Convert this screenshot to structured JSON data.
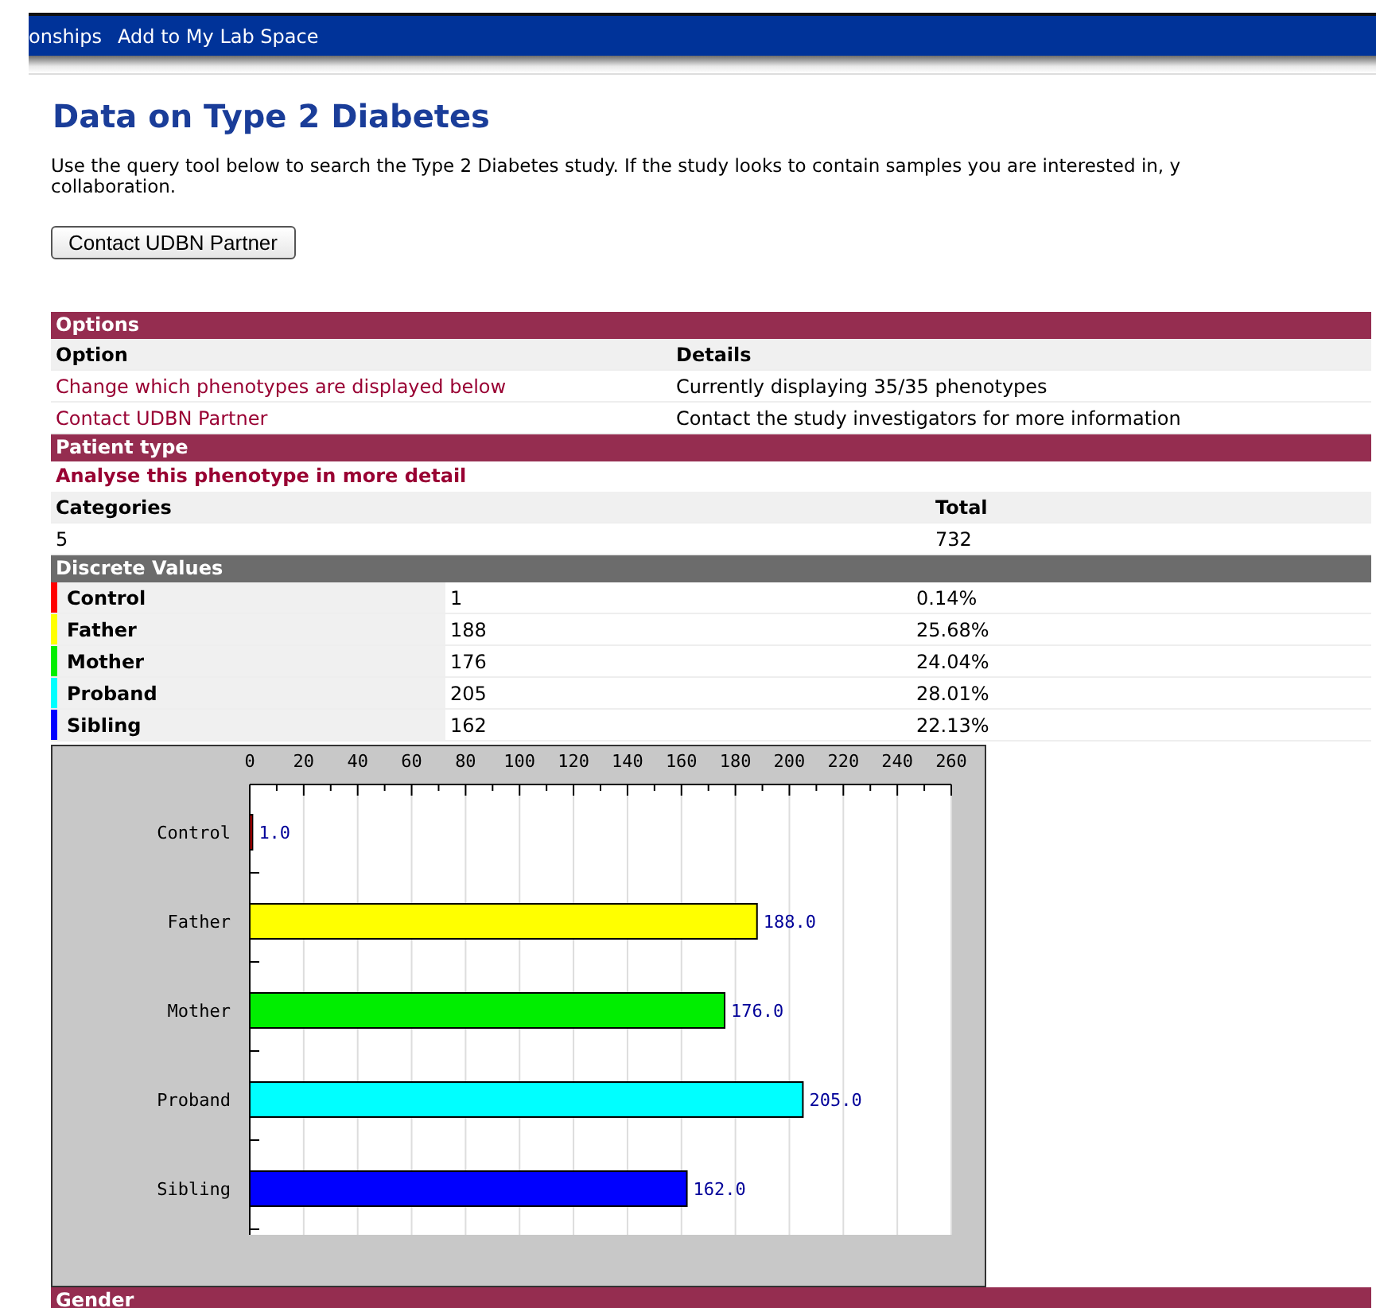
{
  "nav": {
    "items": [
      "onships",
      "Add to My Lab Space"
    ]
  },
  "title": "Data on Type 2 Diabetes",
  "intro": [
    "Use the query tool below to search the Type 2 Diabetes study. If the study looks to contain samples you are interested in, y",
    "collaboration."
  ],
  "contact_button": "Contact UDBN Partner",
  "options": {
    "title": "Options",
    "columns": [
      "Option",
      "Details"
    ],
    "rows": [
      {
        "option": "Change which phenotypes are displayed below",
        "details": "Currently displaying 35/35 phenotypes"
      },
      {
        "option": "Contact UDBN Partner",
        "details": "Contact the study investigators for more information"
      }
    ]
  },
  "patient_type": {
    "title": "Patient type",
    "link": "Analyse this phenotype in more detail",
    "columns": [
      "Categories",
      "Total"
    ],
    "values": [
      "5",
      "732"
    ]
  },
  "discrete_values": {
    "title": "Discrete Values",
    "rows": [
      {
        "label": "Control",
        "count": "1",
        "percent": "0.14%",
        "color": "#ff0000"
      },
      {
        "label": "Father",
        "count": "188",
        "percent": "25.68%",
        "color": "#ffff00"
      },
      {
        "label": "Mother",
        "count": "176",
        "percent": "24.04%",
        "color": "#00ee00"
      },
      {
        "label": "Proband",
        "count": "205",
        "percent": "28.01%",
        "color": "#00ffff"
      },
      {
        "label": "Sibling",
        "count": "162",
        "percent": "22.13%",
        "color": "#0000ff"
      }
    ]
  },
  "chart_data": {
    "type": "bar",
    "orientation": "horizontal",
    "categories": [
      "Control",
      "Father",
      "Mother",
      "Proband",
      "Sibling"
    ],
    "values": [
      1,
      188,
      176,
      205,
      162
    ],
    "xlim": [
      0,
      260
    ],
    "grid": true,
    "xticks": [
      0,
      20,
      40,
      60,
      80,
      100,
      120,
      140,
      160,
      180,
      200,
      220,
      240,
      260
    ],
    "value_labels": [
      "1.0",
      "188.0",
      "176.0",
      "205.0",
      "162.0"
    ]
  },
  "next_section": {
    "title": "Gender"
  }
}
